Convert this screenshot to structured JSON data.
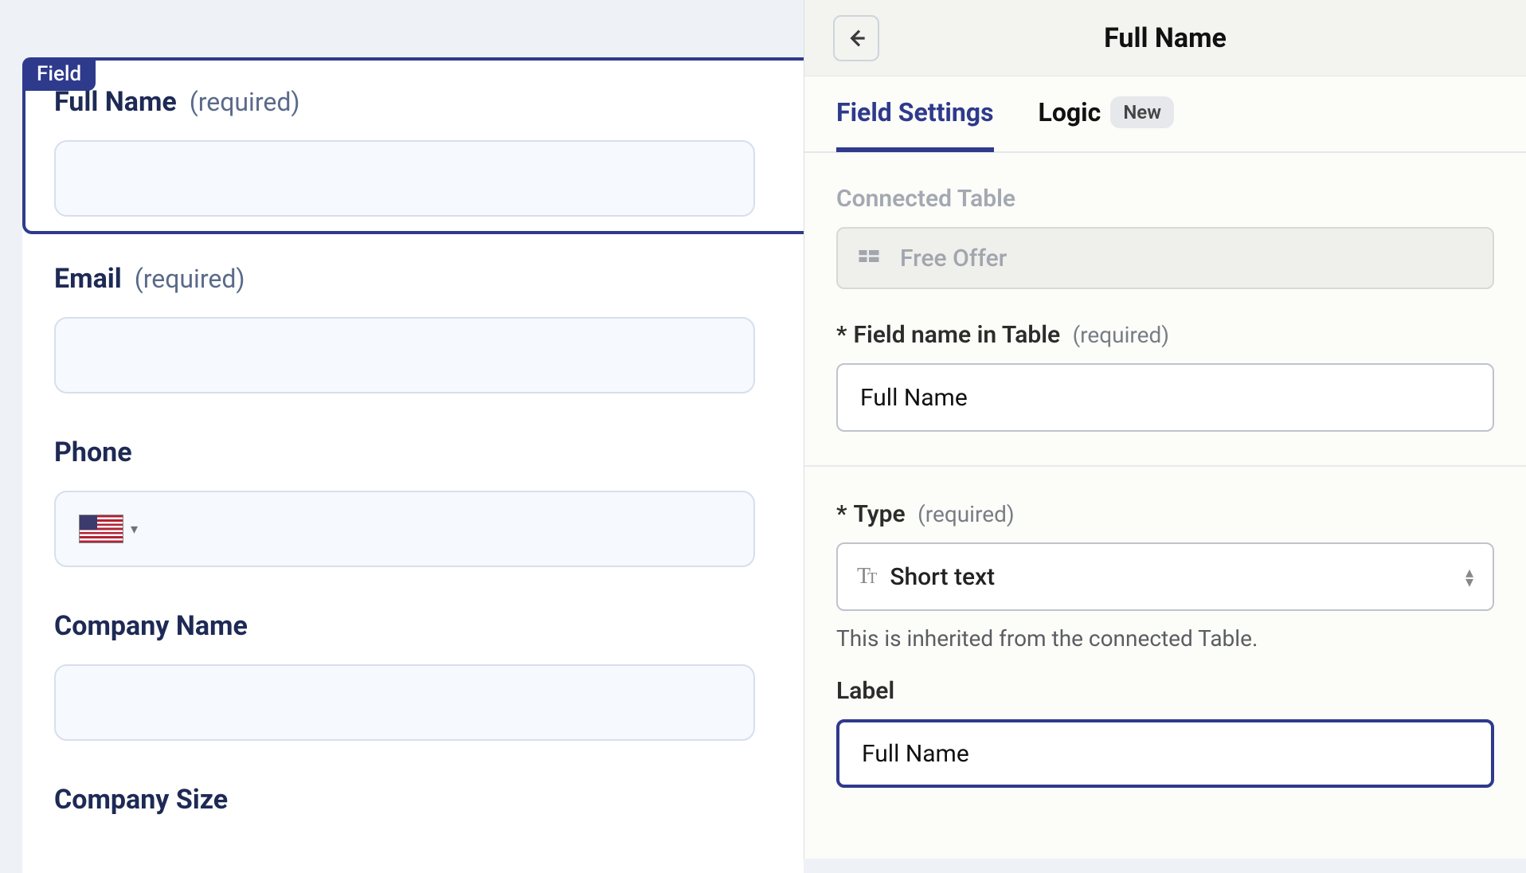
{
  "form": {
    "field_tag": "Field",
    "fields": [
      {
        "label": "Full Name",
        "required_text": "(required)",
        "type": "text",
        "selected": true
      },
      {
        "label": "Email",
        "required_text": "(required)",
        "type": "text"
      },
      {
        "label": "Phone",
        "type": "phone"
      },
      {
        "label": "Company Name",
        "type": "text"
      },
      {
        "label": "Company Size",
        "type": "text"
      }
    ]
  },
  "panel": {
    "title": "Full Name",
    "tabs": {
      "field_settings": "Field Settings",
      "logic": "Logic",
      "logic_badge": "New"
    },
    "connected_table": {
      "label": "Connected Table",
      "value": "Free Offer"
    },
    "field_name": {
      "star": "*",
      "label": "Field name in Table",
      "required_text": "(required)",
      "value": "Full Name"
    },
    "type": {
      "star": "*",
      "label": "Type",
      "required_text": "(required)",
      "value": "Short text",
      "helper": "This is inherited from the connected Table."
    },
    "label_field": {
      "label": "Label",
      "value": "Full Name"
    }
  }
}
